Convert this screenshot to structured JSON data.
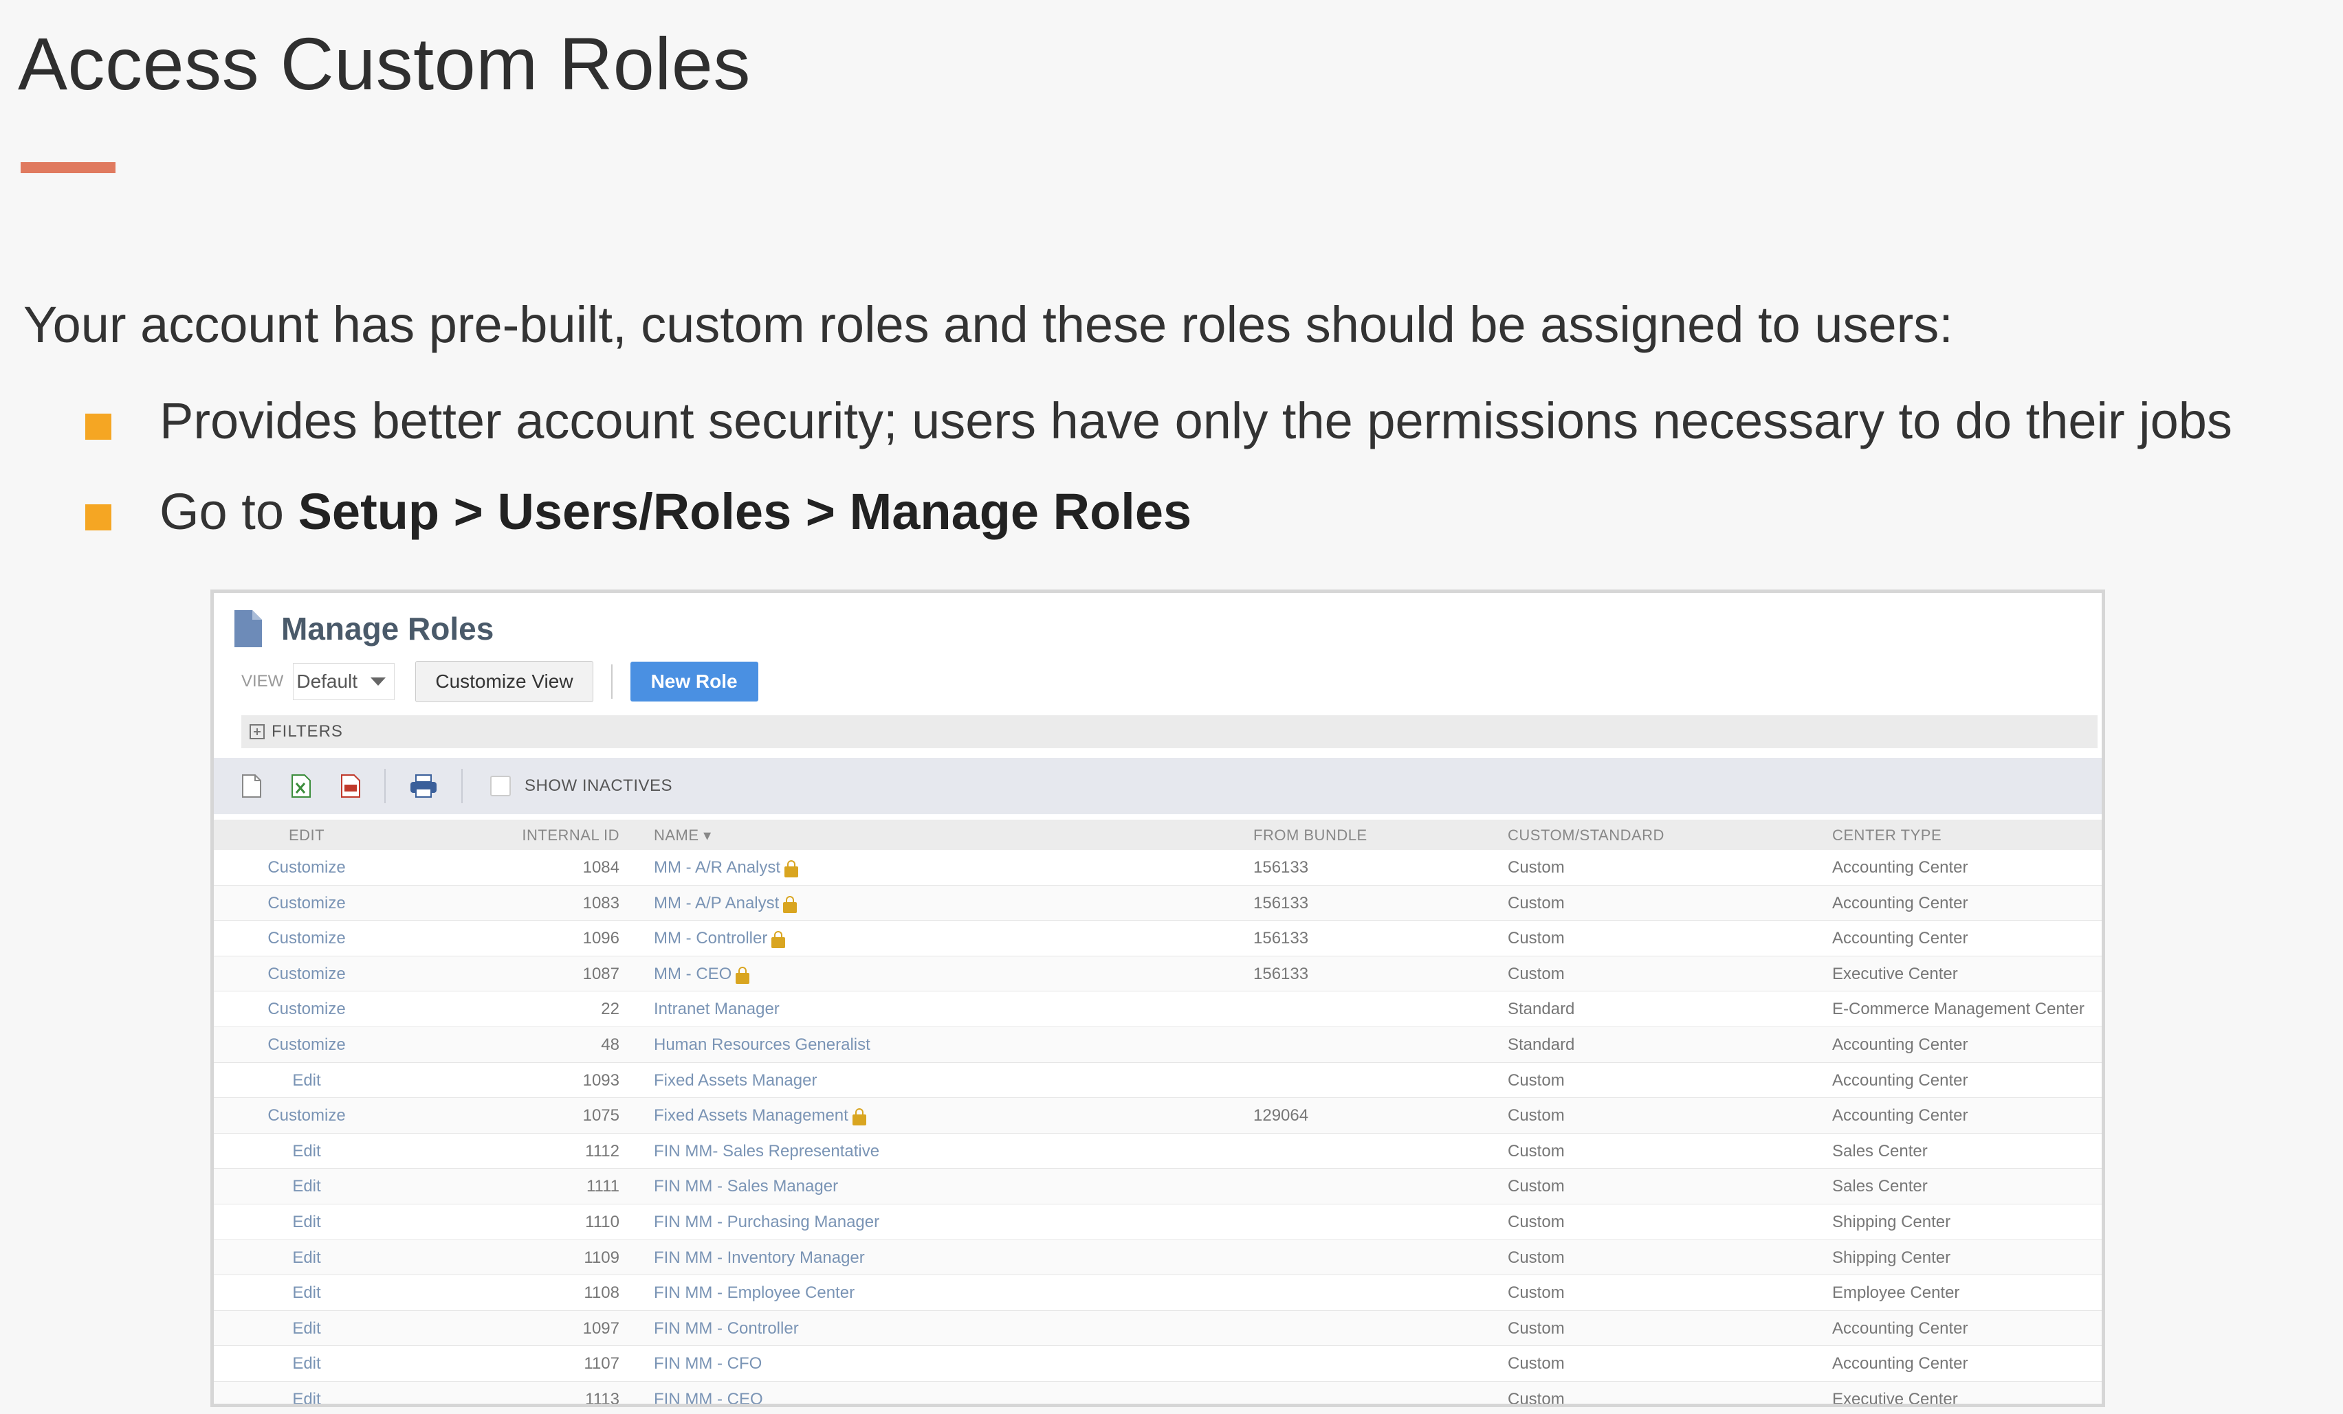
{
  "slide": {
    "title": "Access Custom Roles",
    "accent_color": "#e07a5f",
    "intro": "Your account has pre-built, custom roles and these roles should be assigned to users:",
    "bullet_color": "#f5a623",
    "bullet1": "Provides better account security; users have only the permissions necessary to do their jobs",
    "bullet2_prefix": "Go to ",
    "bullet2_path": "Setup > Users/Roles > Manage Roles"
  },
  "screen": {
    "page_title": "Manage Roles",
    "page_icon": "document-icon",
    "view_label": "VIEW",
    "view_value": "Default",
    "customize_view": "Customize View",
    "new_role": "New Role",
    "filters": "FILTERS",
    "show_inactives": "SHOW INACTIVES",
    "list_icons": [
      "new-document-icon",
      "export-excel-icon",
      "export-pdf-icon",
      "print-icon"
    ],
    "columns": {
      "edit": "EDIT",
      "internal_id": "INTERNAL ID",
      "name": "NAME ▾",
      "from_bundle": "FROM BUNDLE",
      "custom_standard": "CUSTOM/STANDARD",
      "center_type": "CENTER TYPE"
    },
    "rows": [
      {
        "edit": "Customize",
        "id": "1084",
        "name": "MM - A/R Analyst",
        "locked": true,
        "bundle": "156133",
        "cs": "Custom",
        "center": "Accounting Center"
      },
      {
        "edit": "Customize",
        "id": "1083",
        "name": "MM - A/P Analyst",
        "locked": true,
        "bundle": "156133",
        "cs": "Custom",
        "center": "Accounting Center"
      },
      {
        "edit": "Customize",
        "id": "1096",
        "name": "MM - Controller",
        "locked": true,
        "bundle": "156133",
        "cs": "Custom",
        "center": "Accounting Center"
      },
      {
        "edit": "Customize",
        "id": "1087",
        "name": "MM - CEO",
        "locked": true,
        "bundle": "156133",
        "cs": "Custom",
        "center": "Executive Center"
      },
      {
        "edit": "Customize",
        "id": "22",
        "name": "Intranet Manager",
        "locked": false,
        "bundle": "",
        "cs": "Standard",
        "center": "E-Commerce Management Center"
      },
      {
        "edit": "Customize",
        "id": "48",
        "name": "Human Resources Generalist",
        "locked": false,
        "bundle": "",
        "cs": "Standard",
        "center": "Accounting Center"
      },
      {
        "edit": "Edit",
        "id": "1093",
        "name": "Fixed Assets Manager",
        "locked": false,
        "bundle": "",
        "cs": "Custom",
        "center": "Accounting Center"
      },
      {
        "edit": "Customize",
        "id": "1075",
        "name": "Fixed Assets Management",
        "locked": true,
        "bundle": "129064",
        "cs": "Custom",
        "center": "Accounting Center"
      },
      {
        "edit": "Edit",
        "id": "1112",
        "name": "FIN MM- Sales Representative",
        "locked": false,
        "bundle": "",
        "cs": "Custom",
        "center": "Sales Center"
      },
      {
        "edit": "Edit",
        "id": "1111",
        "name": "FIN MM - Sales Manager",
        "locked": false,
        "bundle": "",
        "cs": "Custom",
        "center": "Sales Center"
      },
      {
        "edit": "Edit",
        "id": "1110",
        "name": "FIN MM - Purchasing Manager",
        "locked": false,
        "bundle": "",
        "cs": "Custom",
        "center": "Shipping Center"
      },
      {
        "edit": "Edit",
        "id": "1109",
        "name": "FIN MM - Inventory Manager",
        "locked": false,
        "bundle": "",
        "cs": "Custom",
        "center": "Shipping Center"
      },
      {
        "edit": "Edit",
        "id": "1108",
        "name": "FIN MM - Employee Center",
        "locked": false,
        "bundle": "",
        "cs": "Custom",
        "center": "Employee Center"
      },
      {
        "edit": "Edit",
        "id": "1097",
        "name": "FIN MM - Controller",
        "locked": false,
        "bundle": "",
        "cs": "Custom",
        "center": "Accounting Center"
      },
      {
        "edit": "Edit",
        "id": "1107",
        "name": "FIN MM - CFO",
        "locked": false,
        "bundle": "",
        "cs": "Custom",
        "center": "Accounting Center"
      },
      {
        "edit": "Edit",
        "id": "1113",
        "name": "FIN MM - CEO",
        "locked": false,
        "bundle": "",
        "cs": "Custom",
        "center": "Executive Center"
      }
    ]
  }
}
